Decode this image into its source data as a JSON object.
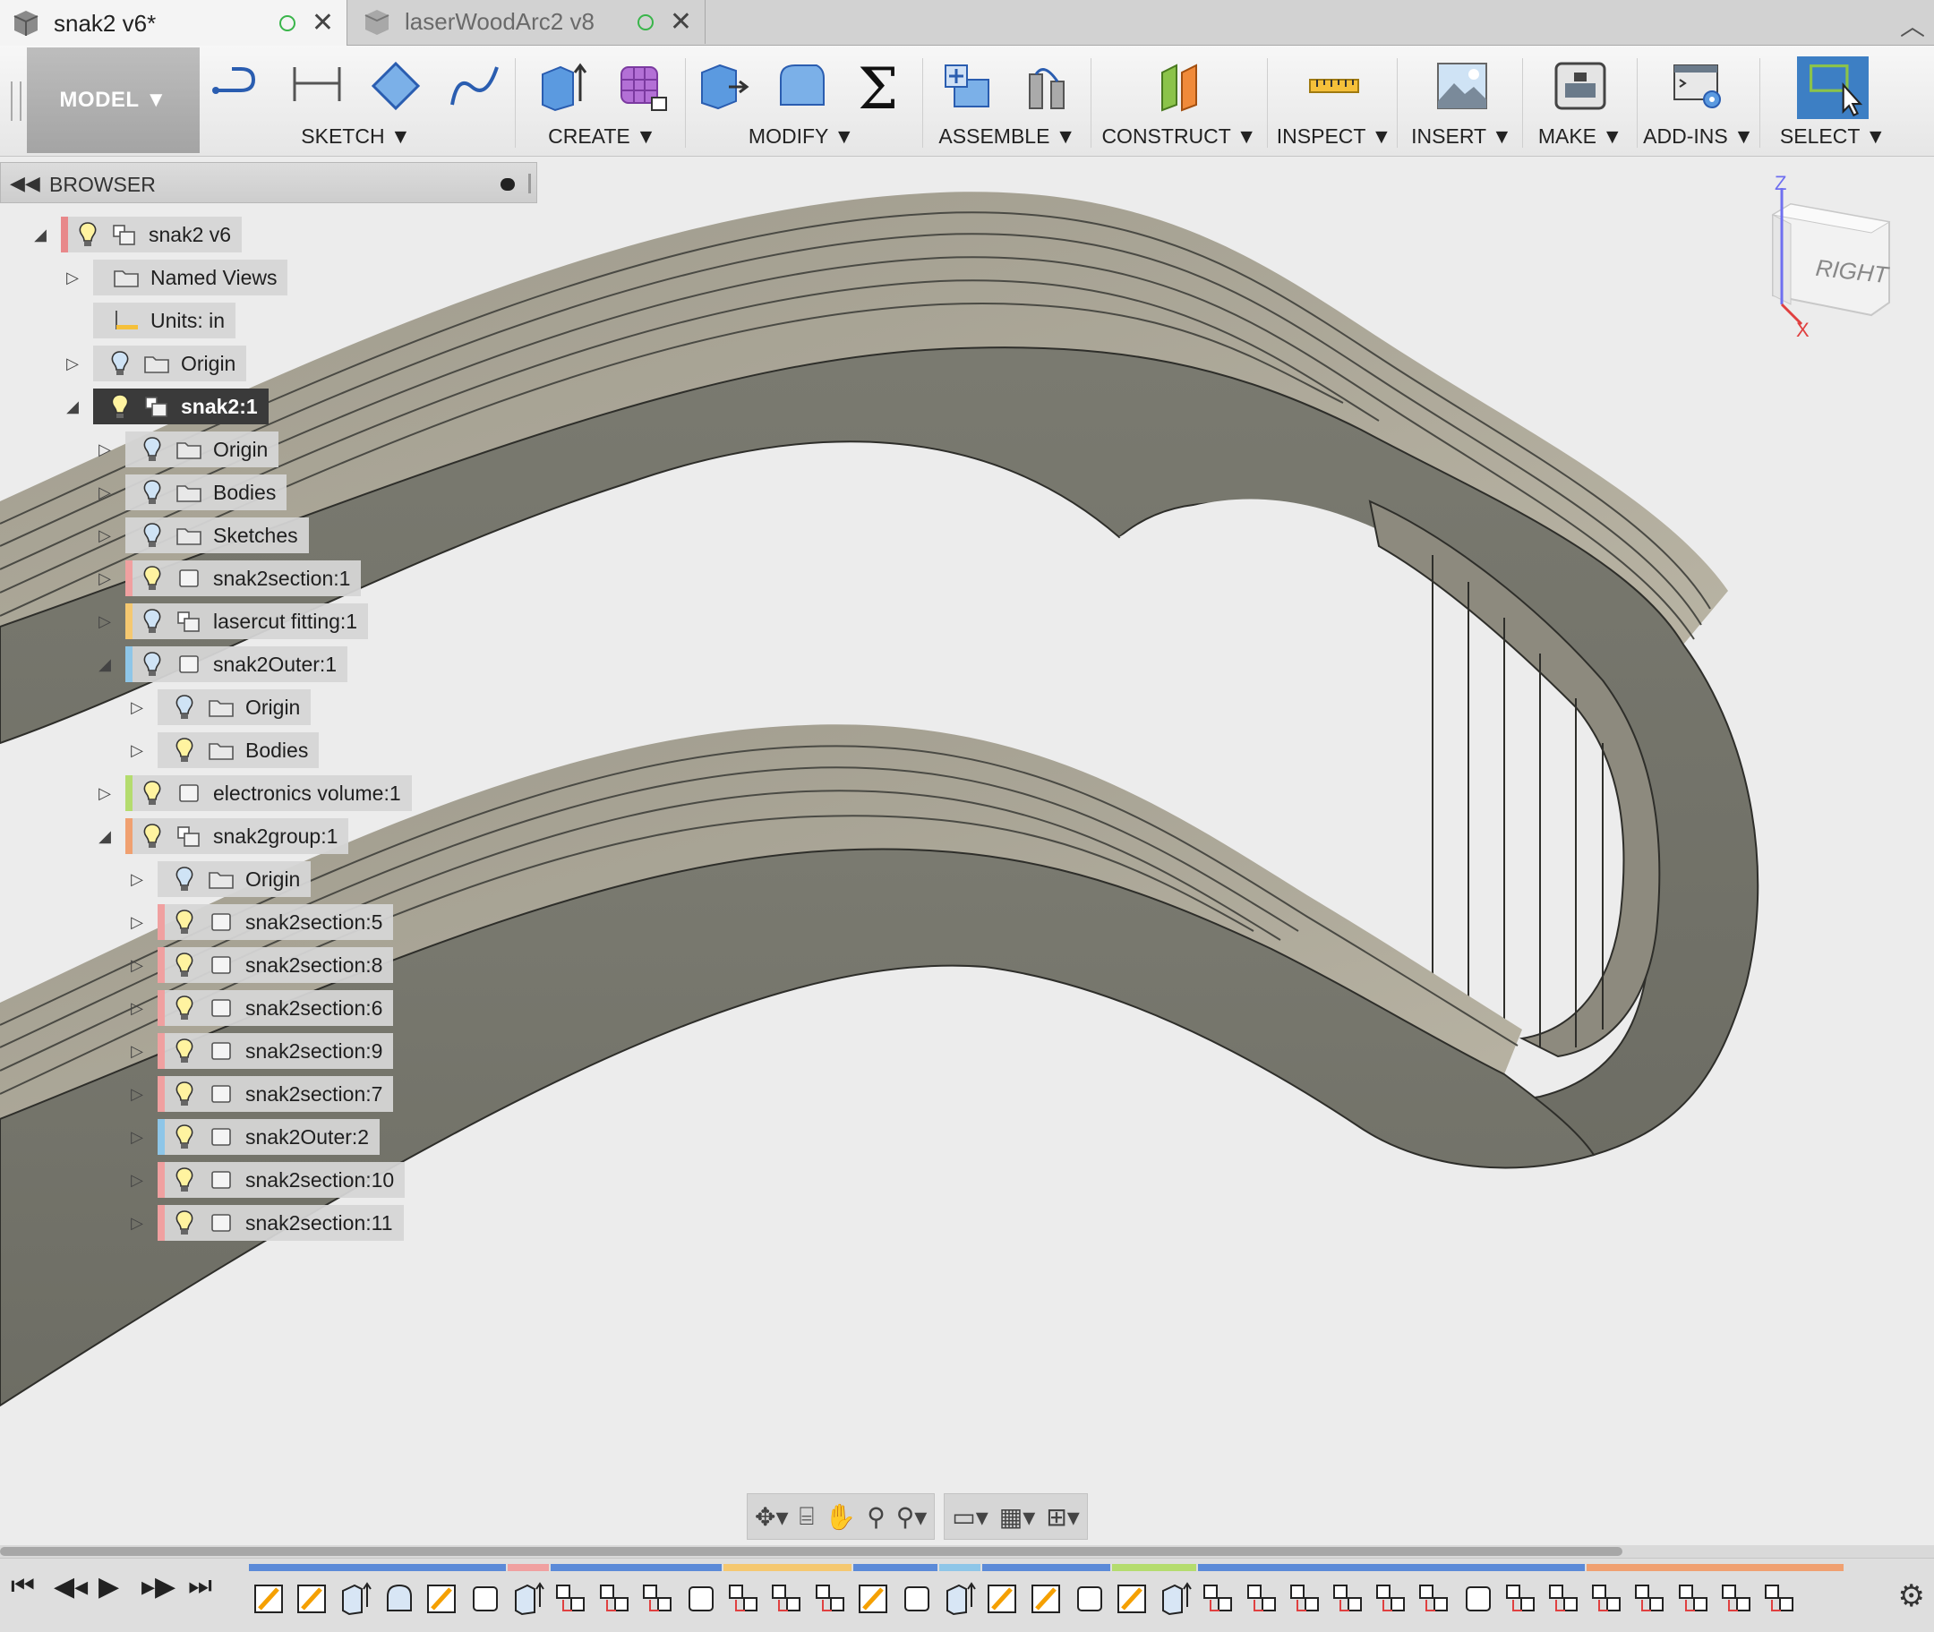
{
  "tabs": [
    {
      "name": "snak2 v6*",
      "active": true
    },
    {
      "name": "laserWoodArc2 v8",
      "active": false
    }
  ],
  "toolbar": {
    "workspace": "MODEL ▼",
    "groups": {
      "sketch": "SKETCH ▼",
      "create": "CREATE ▼",
      "modify": "MODIFY ▼",
      "assemble": "ASSEMBLE ▼",
      "construct": "CONSTRUCT ▼",
      "inspect": "INSPECT ▼",
      "insert": "INSERT ▼",
      "make": "MAKE ▼",
      "addins": "ADD-INS ▼",
      "select": "SELECT ▼"
    }
  },
  "browser": {
    "title": "BROWSER",
    "nodes": [
      {
        "label": "snak2 v6",
        "expand": "open",
        "level": 0,
        "icon": "component-icon",
        "bulb": true,
        "stripe": "#e8888a"
      },
      {
        "label": "Named Views",
        "expand": "closed",
        "level": 1,
        "icon": "folder-icon",
        "bulb": false
      },
      {
        "label": "Units: in",
        "expand": "none",
        "level": 1,
        "icon": "units-icon",
        "bulb": false
      },
      {
        "label": "Origin",
        "expand": "closed",
        "level": 1,
        "icon": "folder-icon",
        "bulb": true,
        "bulbOff": true
      },
      {
        "label": "snak2:1",
        "expand": "open",
        "level": 1,
        "icon": "component-icon",
        "bulb": true,
        "active": true,
        "radio": true
      },
      {
        "label": "Origin",
        "expand": "closed",
        "level": 2,
        "icon": "folder-icon",
        "bulb": true,
        "bulbOff": true
      },
      {
        "label": "Bodies",
        "expand": "closed",
        "level": 2,
        "icon": "folder-icon",
        "bulb": true,
        "bulbOff": true
      },
      {
        "label": "Sketches",
        "expand": "closed",
        "level": 2,
        "icon": "folder-icon",
        "bulb": true,
        "bulbOff": true
      },
      {
        "label": "snak2section:1",
        "expand": "closed",
        "level": 2,
        "icon": "body-icon",
        "bulb": true,
        "stripe": "#f0a0a0"
      },
      {
        "label": "lasercut fitting:1",
        "expand": "closed",
        "level": 2,
        "icon": "component-icon",
        "bulb": true,
        "bulbOff": true,
        "stripe": "#f5c870"
      },
      {
        "label": "snak2Outer:1",
        "expand": "open",
        "level": 2,
        "icon": "body-icon",
        "bulb": true,
        "bulbOff": true,
        "stripe": "#8ec6e8"
      },
      {
        "label": "Origin",
        "expand": "closed",
        "level": 3,
        "icon": "folder-icon",
        "bulb": true,
        "bulbOff": true
      },
      {
        "label": "Bodies",
        "expand": "closed",
        "level": 3,
        "icon": "folder-icon",
        "bulb": true
      },
      {
        "label": "electronics volume:1",
        "expand": "closed",
        "level": 2,
        "icon": "body-icon",
        "bulb": true,
        "stripe": "#b4dc6e"
      },
      {
        "label": "snak2group:1",
        "expand": "open",
        "level": 2,
        "icon": "component-icon",
        "bulb": true,
        "stripe": "#f0a070"
      },
      {
        "label": "Origin",
        "expand": "closed",
        "level": 3,
        "icon": "folder-icon",
        "bulb": true,
        "bulbOff": true
      },
      {
        "label": "snak2section:5",
        "expand": "closed",
        "level": 3,
        "icon": "body-icon",
        "bulb": true,
        "stripe": "#f0a0a0"
      },
      {
        "label": "snak2section:8",
        "expand": "closed",
        "level": 3,
        "icon": "body-icon",
        "bulb": true,
        "stripe": "#f0a0a0"
      },
      {
        "label": "snak2section:6",
        "expand": "closed",
        "level": 3,
        "icon": "body-icon",
        "bulb": true,
        "stripe": "#f0a0a0"
      },
      {
        "label": "snak2section:9",
        "expand": "closed",
        "level": 3,
        "icon": "body-icon",
        "bulb": true,
        "stripe": "#f0a0a0"
      },
      {
        "label": "snak2section:7",
        "expand": "closed",
        "level": 3,
        "icon": "body-icon",
        "bulb": true,
        "stripe": "#f0a0a0"
      },
      {
        "label": "snak2Outer:2",
        "expand": "closed",
        "level": 3,
        "icon": "body-icon",
        "bulb": true,
        "stripe": "#8ec6e8"
      },
      {
        "label": "snak2section:10",
        "expand": "closed",
        "level": 3,
        "icon": "body-icon",
        "bulb": true,
        "stripe": "#f0a0a0"
      },
      {
        "label": "snak2section:11",
        "expand": "closed",
        "level": 3,
        "icon": "body-icon",
        "bulb": true,
        "stripe": "#f0a0a0"
      }
    ]
  },
  "viewcube": {
    "face": "RIGHT",
    "axis_z": "Z",
    "axis_x": "X"
  },
  "timeline": {
    "features": [
      "sketch",
      "sketch",
      "extrude",
      "revolve",
      "sketch",
      "body",
      "extrude",
      "component",
      "component",
      "component",
      "body",
      "component",
      "component",
      "component",
      "sketch",
      "body",
      "extrude",
      "sketch",
      "sketch",
      "body",
      "sketch",
      "extrude",
      "component",
      "component",
      "component",
      "component",
      "component",
      "component",
      "body",
      "component",
      "component",
      "component",
      "component",
      "component",
      "component",
      "component"
    ]
  }
}
